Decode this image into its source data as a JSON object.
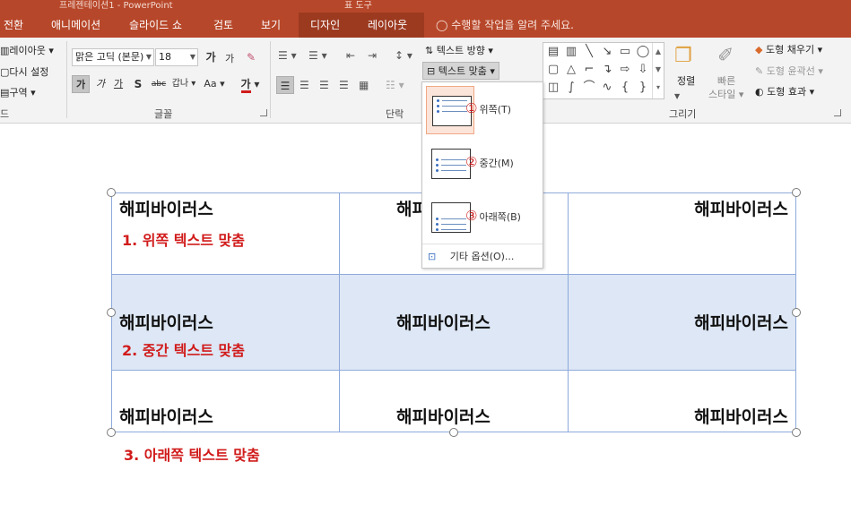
{
  "titlebar": {
    "app_title": "프레젠테이션1 - PowerPoint",
    "context_tool": "표 도구"
  },
  "tabs": [
    {
      "label": "전환"
    },
    {
      "label": "애니메이션"
    },
    {
      "label": "슬라이드 쇼"
    },
    {
      "label": "검토"
    },
    {
      "label": "보기"
    },
    {
      "label": "디자인"
    },
    {
      "label": "레이아웃"
    }
  ],
  "tell_me": "수행할 작업을 알려 주세요.",
  "ribbon": {
    "slides": {
      "layout": "레이아웃",
      "reset": "다시 설정",
      "section": "구역",
      "group_label": "드"
    },
    "font": {
      "font_name": "맑은 고딕 (본문)",
      "font_size": "18",
      "grow": "가",
      "shrink": "가",
      "bold": "가",
      "italic": "가",
      "underline": "가",
      "shadow": "S",
      "strike": "abc",
      "spacing": "갑나",
      "case": "Aa",
      "color_letter": "가",
      "group_label": "글꼴"
    },
    "paragraph": {
      "group_label": "단락"
    },
    "text_direction": "텍스트 방향",
    "text_align": "텍스트 맞춤",
    "drawing": {
      "arrange": "정렬",
      "quick_styles_1": "빠른",
      "quick_styles_2": "스타일",
      "fill": "도형 채우기",
      "outline": "도형 윤곽선",
      "effects": "도형 효과",
      "group_label": "그리기"
    },
    "colors": {
      "accent": "#b7472a",
      "tool_tab": "#9c3a20",
      "font_red": "#d11b1b"
    }
  },
  "dropdown": {
    "items": [
      {
        "num": "①",
        "label": "위쪽(T)"
      },
      {
        "num": "②",
        "label": "중간(M)"
      },
      {
        "num": "③",
        "label": "아래쪽(B)"
      }
    ],
    "more": "기타 옵션(O)..."
  },
  "table": {
    "rows": [
      [
        "해피바이러스",
        "해피바이러스",
        "해피바이러스"
      ],
      [
        "해피바이러스",
        "해피바이러스",
        "해피바이러스"
      ],
      [
        "해피바이러스",
        "해피바이러스",
        "해피바이러스"
      ]
    ],
    "notes": [
      "1. 위쪽 텍스트 맞춤",
      "2. 중간 텍스트 맞춤",
      "3. 아래쪽 텍스트 맞춤"
    ],
    "colors": {
      "middle_row_fill": "#dde7f5",
      "border": "#8eaadb",
      "note": "#d11b1b"
    }
  }
}
